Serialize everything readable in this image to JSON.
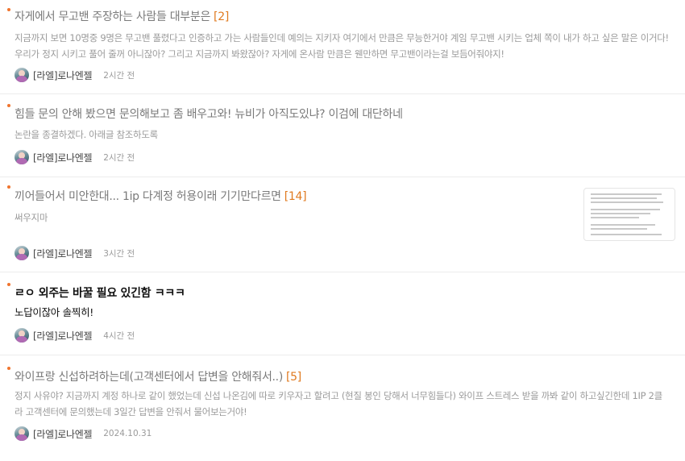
{
  "posts": [
    {
      "title": "자게에서 무고밴 주장하는 사람들 대부분은",
      "comment_count": "[2]",
      "body": "지금까지 보면 10명중 9명은 무고밴 풀렸다고 인증하고 가는 사람들인데 예의는 지키자 여기에서 만큼은 무능한거야 계임 무고밴 시키는 업체 쪽이 내가 하고 싶은 말은 이거다! 우리가 정지 시키고 풀어 줄꺼 아니잖아? 그리고 지금까지 봐왔잖아? 자게에 온사람 만큼은 웬만하면 무고밴이라는걸 보듬어줘야지!",
      "author": "[라엘]로나엔젤",
      "time": "2시간 전"
    },
    {
      "title": "힘들 문의 안해 봤으면 문의해보고 좀 배우고와! 뉴비가 아직도있냐? 이검에 대단하네",
      "comment_count": "",
      "body": "논란을 종결하겠다. 아래글 참조하도록",
      "author": "[라엘]로나엔젤",
      "time": "2시간 전"
    },
    {
      "title": "끼어들어서 미안한대... 1ip 다계정 허용이래 기기만다르면",
      "comment_count": "[14]",
      "body": "써우지마",
      "author": "[라엘]로나엔젤",
      "time": "3시간 전",
      "has_thumbnail": true
    },
    {
      "title": "ㄹㅇ 외주는 바꿀 필요 있긴함 ㅋㅋㅋ",
      "comment_count": "",
      "body": "노답이잖아 솔찍히!",
      "author": "[라엘]로나엔젤",
      "time": "4시간 전",
      "unread": true
    },
    {
      "title": "와이프랑 신섭하려하는데(고객센터에서 답변을 안해줘서..)",
      "comment_count": "[5]",
      "body": "정지 사유야? 지금까지 계정 하나로 같이 했었는데 신섭 나온김에 따로 키우자고 할려고 (현질 봉인 당해서 너무힘들다) 와이프 스트레스 받을 까봐 같이 하고싶긴한데 1IP 2클라 고객센터에 문의했는데 3일간 답변을 안줘서 물어보는거야!",
      "author": "[라엘]로나엔젤",
      "time": "2024.10.31"
    }
  ],
  "colors": {
    "accent": "#e07a1f",
    "dot": "#f0742e",
    "divider": "#ececec"
  }
}
